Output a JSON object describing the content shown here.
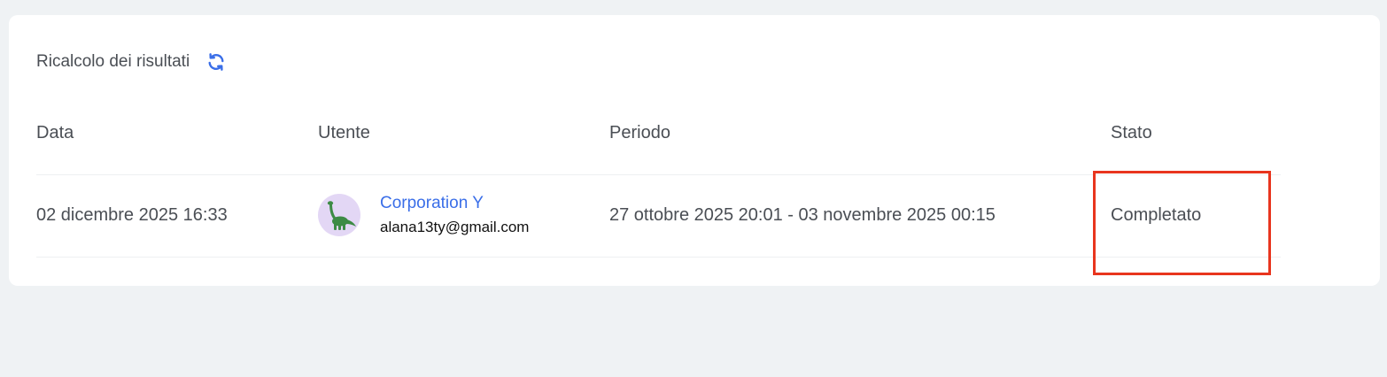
{
  "card": {
    "title": "Ricalcolo dei risultati",
    "refresh_icon": "refresh-icon"
  },
  "table": {
    "headers": {
      "data": "Data",
      "user": "Utente",
      "period": "Periodo",
      "state": "Stato"
    },
    "rows": [
      {
        "date": "02 dicembre 2025 16:33",
        "user_name": "Corporation Y",
        "user_email": "alana13ty@gmail.com",
        "avatar_icon": "dinosaur-icon",
        "period": "27 ottobre 2025 20:01 - 03 novembre 2025 00:15",
        "state": "Completato"
      }
    ]
  },
  "colors": {
    "accent": "#3a6ee8",
    "highlight": "#e8351e",
    "avatar_bg": "#e3d7f5",
    "dino": "#3d8b45"
  }
}
